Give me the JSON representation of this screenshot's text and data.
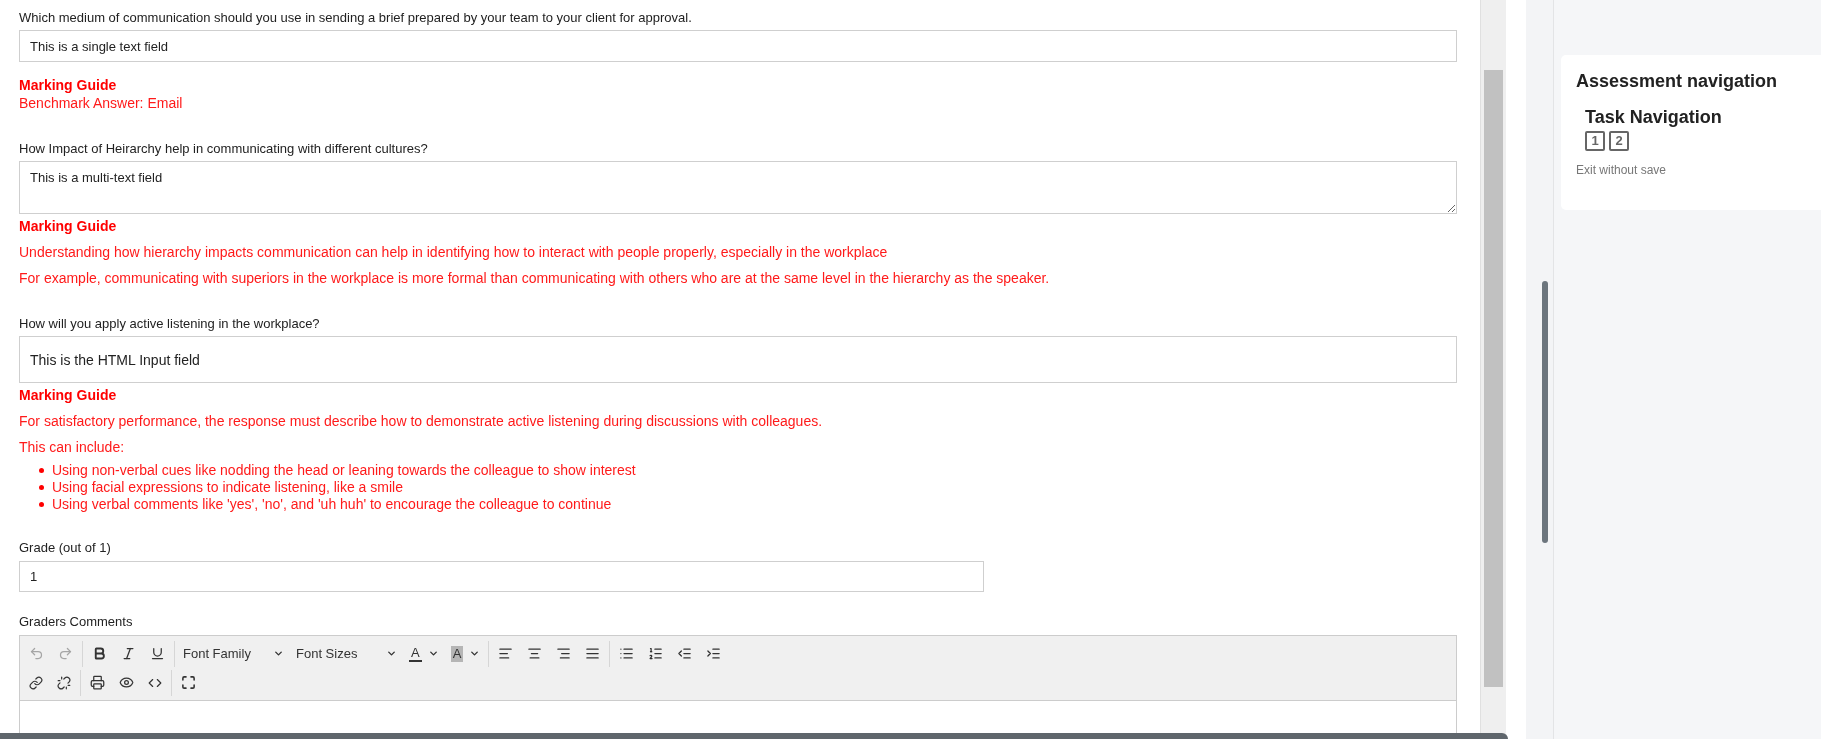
{
  "questions": [
    {
      "prompt": "Which medium of communication should you use in sending a brief prepared by your team to your client for approval.",
      "field": {
        "kind": "single",
        "value": "This is a single text field"
      },
      "guide": {
        "kind": "compact",
        "title": "Marking Guide",
        "paragraphs": [
          "Benchmark Answer: Email"
        ]
      }
    },
    {
      "prompt": "How Impact of Heirarchy help in communicating with different cultures?",
      "field": {
        "kind": "multi",
        "value": "This is a multi-text field"
      },
      "guide": {
        "kind": "spaced",
        "title": "Marking Guide",
        "paragraphs": [
          "Understanding how hierarchy impacts communication can help in identifying how to interact with people properly, especially in the workplace",
          "For example, communicating with superiors in the workplace is more formal than communicating with others who are at the same level in the hierarchy as the speaker."
        ]
      }
    },
    {
      "prompt": "How will you apply active listening in the workplace?",
      "field": {
        "kind": "html",
        "value": "This is the HTML Input field"
      },
      "guide": {
        "kind": "spaced",
        "title": "Marking Guide",
        "paragraphs": [
          "For satisfactory performance, the response must describe how to demonstrate active listening during discussions with colleagues.",
          "This can include:"
        ],
        "bullets": [
          "Using non-verbal cues like nodding the head or leaning towards the colleague to show interest",
          "Using facial expressions to indicate listening, like a smile",
          "Using verbal comments like 'yes', 'no', and 'uh huh' to encourage the colleague to continue"
        ]
      }
    }
  ],
  "grade": {
    "label": "Grade (out of 1)",
    "value": "1"
  },
  "comments": {
    "label": "Graders Comments",
    "toolbar": {
      "undo_disabled": true,
      "redo_disabled": true,
      "font_family": "Font Family",
      "font_sizes": "Font Sizes",
      "text_color_letter": "A",
      "bg_color_letter": "A"
    }
  },
  "navigation": {
    "title": "Assessment navigation",
    "task_nav": {
      "title": "Task Navigation",
      "tasks": [
        {
          "label": "1"
        },
        {
          "label": "2"
        }
      ]
    },
    "exit": "Exit without save"
  }
}
